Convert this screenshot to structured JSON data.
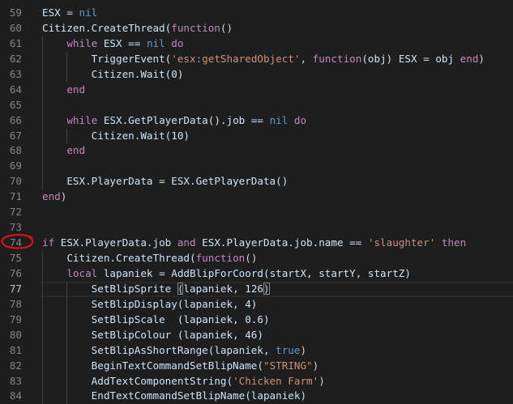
{
  "editor": {
    "active_line": 77,
    "lines": [
      {
        "n": "59",
        "indent": 0,
        "tokens": [
          [
            "ESX = ",
            "id"
          ],
          [
            "nil",
            "c"
          ]
        ]
      },
      {
        "n": "60",
        "indent": 0,
        "tokens": [
          [
            "Citizen.CreateThread(",
            "id"
          ],
          [
            "function",
            "k"
          ],
          [
            "()",
            "p"
          ]
        ]
      },
      {
        "n": "61",
        "indent": 1,
        "tokens": [
          [
            "while",
            "k"
          ],
          [
            " ESX == ",
            "id"
          ],
          [
            "nil",
            "c"
          ],
          [
            " ",
            "p"
          ],
          [
            "do",
            "k"
          ]
        ]
      },
      {
        "n": "62",
        "indent": 2,
        "tokens": [
          [
            "TriggerEvent(",
            "id"
          ],
          [
            "'esx:getSharedObject'",
            "s"
          ],
          [
            ", ",
            "p"
          ],
          [
            "function",
            "k"
          ],
          [
            "(obj) ESX = obj ",
            "id"
          ],
          [
            "end",
            "k"
          ],
          [
            ")",
            "p"
          ]
        ]
      },
      {
        "n": "63",
        "indent": 2,
        "tokens": [
          [
            "Citizen.Wait(0)",
            "id"
          ]
        ]
      },
      {
        "n": "64",
        "indent": 1,
        "tokens": [
          [
            "end",
            "k"
          ]
        ]
      },
      {
        "n": "65",
        "indent": 0,
        "tokens": []
      },
      {
        "n": "66",
        "indent": 1,
        "tokens": [
          [
            "while",
            "k"
          ],
          [
            " ESX.GetPlayerData().job == ",
            "id"
          ],
          [
            "nil",
            "c"
          ],
          [
            " ",
            "p"
          ],
          [
            "do",
            "k"
          ]
        ]
      },
      {
        "n": "67",
        "indent": 2,
        "tokens": [
          [
            "Citizen.Wait(10)",
            "id"
          ]
        ]
      },
      {
        "n": "68",
        "indent": 1,
        "tokens": [
          [
            "end",
            "k"
          ]
        ]
      },
      {
        "n": "69",
        "indent": 0,
        "tokens": []
      },
      {
        "n": "70",
        "indent": 1,
        "tokens": [
          [
            "ESX.PlayerData = ESX.GetPlayerData()",
            "id"
          ]
        ]
      },
      {
        "n": "71",
        "indent": 0,
        "tokens": [
          [
            "end",
            "k"
          ],
          [
            ")",
            "p"
          ]
        ]
      },
      {
        "n": "72",
        "indent": 0,
        "tokens": []
      },
      {
        "n": "73",
        "indent": 0,
        "tokens": []
      },
      {
        "n": "74",
        "indent": 0,
        "tokens": [
          [
            "if",
            "k"
          ],
          [
            " ESX.PlayerData.job ",
            "id"
          ],
          [
            "and",
            "k"
          ],
          [
            " ESX.PlayerData.job.name == ",
            "id"
          ],
          [
            "'slaughter'",
            "s"
          ],
          [
            " ",
            "p"
          ],
          [
            "then",
            "k"
          ]
        ]
      },
      {
        "n": "75",
        "indent": 1,
        "tokens": [
          [
            "Citizen.CreateThread(",
            "id"
          ],
          [
            "function",
            "k"
          ],
          [
            "()",
            "p"
          ]
        ]
      },
      {
        "n": "76",
        "indent": 1,
        "tokens": [
          [
            "local",
            "k"
          ],
          [
            " lapaniek = AddBlipForCoord(startX, startY, startZ)",
            "id"
          ]
        ]
      },
      {
        "n": "77",
        "indent": 2,
        "tokens": [
          [
            "SetBlipSprite ",
            "id"
          ],
          [
            "(",
            "b"
          ],
          [
            "lapaniek, 126",
            "id"
          ],
          [
            ")",
            "b"
          ]
        ]
      },
      {
        "n": "78",
        "indent": 2,
        "tokens": [
          [
            "SetBlipDisplay(lapaniek, 4)",
            "id"
          ]
        ]
      },
      {
        "n": "79",
        "indent": 2,
        "tokens": [
          [
            "SetBlipScale  (lapaniek, 0.6)",
            "id"
          ]
        ]
      },
      {
        "n": "80",
        "indent": 2,
        "tokens": [
          [
            "SetBlipColour (lapaniek, 46)",
            "id"
          ]
        ]
      },
      {
        "n": "81",
        "indent": 2,
        "tokens": [
          [
            "SetBlipAsShortRange(lapaniek, ",
            "id"
          ],
          [
            "true",
            "c"
          ],
          [
            ")",
            "p"
          ]
        ]
      },
      {
        "n": "82",
        "indent": 2,
        "tokens": [
          [
            "BeginTextCommandSetBlipName(",
            "id"
          ],
          [
            "\"STRING\"",
            "s"
          ],
          [
            ")",
            "p"
          ]
        ]
      },
      {
        "n": "83",
        "indent": 2,
        "tokens": [
          [
            "AddTextComponentString(",
            "id"
          ],
          [
            "'Chicken Farm'",
            "s"
          ],
          [
            ")",
            "p"
          ]
        ]
      },
      {
        "n": "84",
        "indent": 2,
        "tokens": [
          [
            "EndTextCommandSetBlipName(lapaniek)",
            "id"
          ]
        ]
      }
    ]
  },
  "annotation": {
    "color": "#e0141a"
  }
}
